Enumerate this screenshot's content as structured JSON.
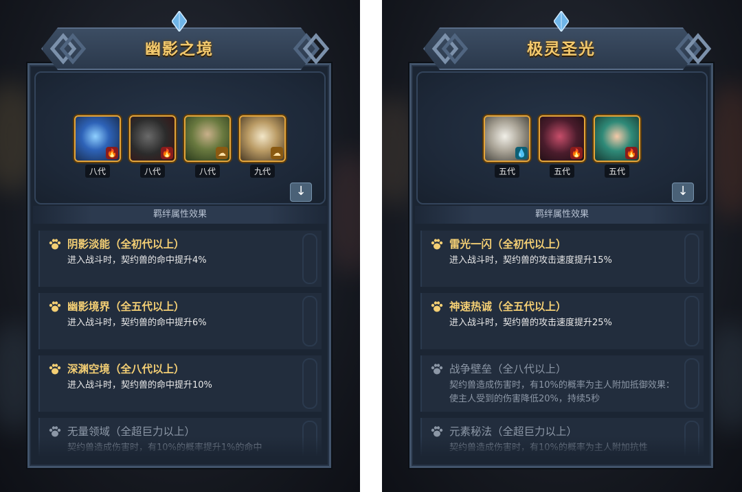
{
  "panels": [
    {
      "title": "幽影之境",
      "section_label": "羁绊属性效果",
      "members": [
        {
          "gen": "八代",
          "element": "fire-icon",
          "glyph": "🔥"
        },
        {
          "gen": "八代",
          "element": "fire-icon",
          "glyph": "🔥"
        },
        {
          "gen": "八代",
          "element": "earth-icon",
          "glyph": "☁"
        },
        {
          "gen": "九代",
          "element": "earth-icon",
          "glyph": "☁"
        }
      ],
      "effects": [
        {
          "name": "阴影淡能（全初代以上）",
          "desc": "进入战斗时，契约兽的命中提升4%",
          "active": true
        },
        {
          "name": "幽影境界（全五代以上）",
          "desc": "进入战斗时，契约兽的命中提升6%",
          "active": true
        },
        {
          "name": "深渊空境（全八代以上）",
          "desc": "进入战斗时，契约兽的命中提升10%",
          "active": true
        },
        {
          "name": "无量领域（全超巨力以上）",
          "desc": "契约兽造成伤害时，有10%的概率提升1%的命中",
          "active": false
        }
      ]
    },
    {
      "title": "极灵圣光",
      "section_label": "羁绊属性效果",
      "members": [
        {
          "gen": "五代",
          "element": "water-icon",
          "glyph": "💧"
        },
        {
          "gen": "五代",
          "element": "fire-icon",
          "glyph": "🔥"
        },
        {
          "gen": "五代",
          "element": "fire-icon",
          "glyph": "🔥"
        }
      ],
      "effects": [
        {
          "name": "雷光一闪（全初代以上）",
          "desc": "进入战斗时，契约兽的攻击速度提升15%",
          "active": true
        },
        {
          "name": "神速热诚（全五代以上）",
          "desc": "进入战斗时，契约兽的攻击速度提升25%",
          "active": true
        },
        {
          "name": "战争壁垒（全八代以上）",
          "desc": "契约兽造成伤害时，有10%的概率为主人附加抵御效果：使主人受到的伤害降低20%，持续5秒",
          "active": false
        },
        {
          "name": "元素秘法（全超巨力以上）",
          "desc": "契约兽造成伤害时，有10%的概率为主人附加抗性",
          "active": false
        }
      ]
    }
  ],
  "colors": {
    "title": "#f3c96d",
    "active_name": "#f4cf74",
    "inactive": "#8c97a6",
    "frame": "#42546b"
  }
}
